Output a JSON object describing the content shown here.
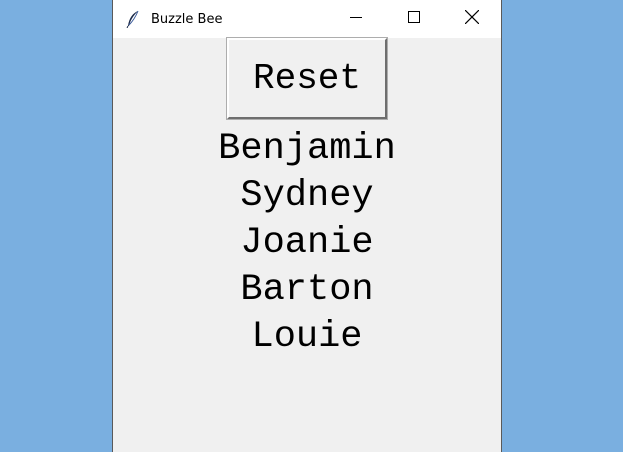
{
  "window": {
    "title": "Buzzle Bee",
    "icon": "feather-icon",
    "controls": [
      "minimize-icon",
      "maximize-icon",
      "close-icon"
    ]
  },
  "main": {
    "reset_label": "Reset",
    "names": [
      "Benjamin",
      "Sydney",
      "Joanie",
      "Barton",
      "Louie"
    ]
  },
  "colors": {
    "desktop": "#7aafe0",
    "window_bg": "#f0f0f0",
    "titlebar_bg": "#ffffff"
  }
}
